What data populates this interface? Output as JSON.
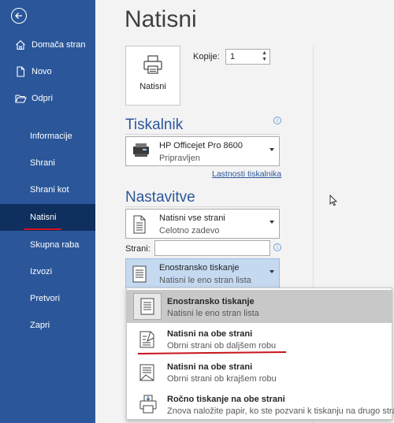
{
  "sidebar": {
    "items": [
      {
        "label": "Domača stran",
        "icon": "home-icon"
      },
      {
        "label": "Novo",
        "icon": "new-document-icon"
      },
      {
        "label": "Odpri",
        "icon": "folder-open-icon"
      },
      {
        "label": "Informacije"
      },
      {
        "label": "Shrani"
      },
      {
        "label": "Shrani kot"
      },
      {
        "label": "Natisni"
      },
      {
        "label": "Skupna raba"
      },
      {
        "label": "Izvozi"
      },
      {
        "label": "Pretvori"
      },
      {
        "label": "Zapri"
      }
    ],
    "active": "Natisni"
  },
  "main": {
    "title": "Natisni",
    "print_button_label": "Natisni",
    "copies_label": "Kopije:",
    "copies_value": "1",
    "printer_section_title": "Tiskalnik",
    "printer": {
      "name": "HP Officejet Pro 8600",
      "status": "Pripravljen"
    },
    "printer_properties_link": "Lastnosti tiskalnika",
    "settings_section_title": "Nastavitve",
    "print_range": {
      "line1": "Natisni vse strani",
      "line2": "Celotno zadevo"
    },
    "pages_label": "Strani:",
    "pages_value": "",
    "duplex_selected": {
      "line1": "Enostransko tiskanje",
      "line2": "Natisni le eno stran lista"
    }
  },
  "duplex_options": [
    {
      "title": "Enostransko tiskanje",
      "subtitle": "Natisni le eno stran lista"
    },
    {
      "title": "Natisni na obe strani",
      "subtitle": "Obrni strani ob daljšem robu"
    },
    {
      "title": "Natisni na obe strani",
      "subtitle": "Obrni strani ob krajšem robu"
    },
    {
      "title": "Ročno tiskanje na obe strani",
      "subtitle": "Znova naložite papir, ko ste pozvani k tiskanju na drugo stran"
    }
  ],
  "colors": {
    "sidebar": "#2b579a",
    "active_item": "#0f2f5f",
    "accent": "#2b579a",
    "annotation_red": "#d4141e",
    "selected_dropdown": "#c5d9f1",
    "hover_option": "#c8c8c8"
  }
}
